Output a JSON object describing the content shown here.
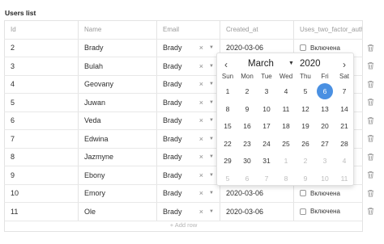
{
  "title": "Users list",
  "columns": [
    "Id",
    "Name",
    "Email",
    "Created_at",
    "Uses_two_factor_auth"
  ],
  "rows": [
    {
      "id": "2",
      "name": "Brady",
      "email": "Brady",
      "created": "2020-03-06",
      "tfa": "Включена"
    },
    {
      "id": "3",
      "name": "Bulah",
      "email": "Brady",
      "created": "",
      "tfa": ""
    },
    {
      "id": "4",
      "name": "Geovany",
      "email": "Brady",
      "created": "",
      "tfa": ""
    },
    {
      "id": "5",
      "name": "Juwan",
      "email": "Brady",
      "created": "",
      "tfa": ""
    },
    {
      "id": "6",
      "name": "Veda",
      "email": "Brady",
      "created": "",
      "tfa": ""
    },
    {
      "id": "7",
      "name": "Edwina",
      "email": "Brady",
      "created": "",
      "tfa": ""
    },
    {
      "id": "8",
      "name": "Jazmyne",
      "email": "Brady",
      "created": "",
      "tfa": ""
    },
    {
      "id": "9",
      "name": "Ebony",
      "email": "Brady",
      "created": "",
      "tfa": ""
    },
    {
      "id": "10",
      "name": "Emory",
      "email": "Brady",
      "created": "2020-03-06",
      "tfa": "Включена"
    },
    {
      "id": "11",
      "name": "Ole",
      "email": "Brady",
      "created": "2020-03-06",
      "tfa": "Включена"
    }
  ],
  "clear_glyph": "×",
  "add_row": "+ Add row",
  "icons": {
    "delete": "trash-icon",
    "clear": "close-icon",
    "dropdown": "chevron-down-icon"
  },
  "datepicker": {
    "prev": "‹",
    "next": "›",
    "month": "March",
    "year": "2020",
    "weekdays": [
      "Sun",
      "Mon",
      "Tue",
      "Wed",
      "Thu",
      "Fri",
      "Sat"
    ],
    "weeks": [
      [
        "1",
        "2",
        "3",
        "4",
        "5",
        "6",
        "7"
      ],
      [
        "8",
        "9",
        "10",
        "11",
        "12",
        "13",
        "14"
      ],
      [
        "15",
        "16",
        "17",
        "18",
        "19",
        "20",
        "21"
      ],
      [
        "22",
        "23",
        "24",
        "25",
        "26",
        "27",
        "28"
      ],
      [
        "29",
        "30",
        "31",
        "1",
        "2",
        "3",
        "4"
      ],
      [
        "5",
        "6",
        "7",
        "8",
        "9",
        "10",
        "11"
      ]
    ],
    "selected_day": "6",
    "accent_color": "#4a90e2"
  }
}
